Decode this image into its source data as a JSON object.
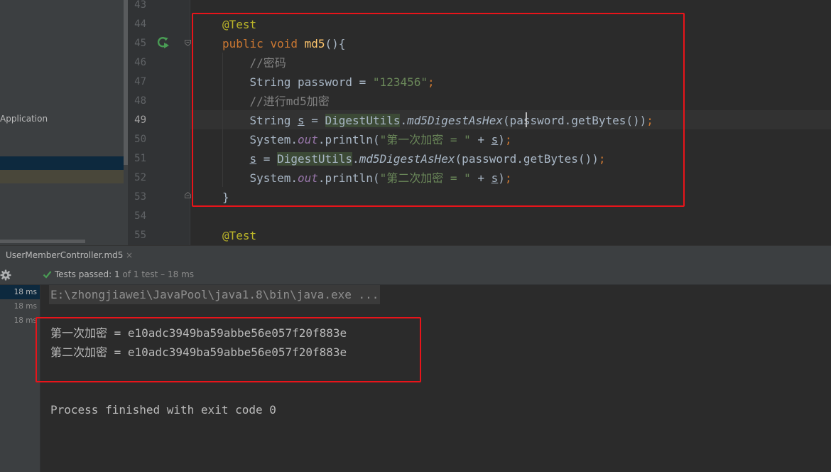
{
  "sidebar": {
    "app_label": "Application"
  },
  "editor": {
    "line_numbers": [
      "43",
      "44",
      "45",
      "46",
      "47",
      "48",
      "49",
      "50",
      "51",
      "52",
      "53",
      "54",
      "55"
    ],
    "lines": [
      [],
      [
        [
          "annot",
          "@Test"
        ]
      ],
      [
        [
          "kw",
          "public "
        ],
        [
          "kw",
          "void "
        ],
        [
          "fn",
          "md5"
        ],
        [
          "plain",
          "(){"
        ]
      ],
      [
        [
          "plain",
          "    "
        ],
        [
          "cmt",
          "//密码"
        ]
      ],
      [
        [
          "plain",
          "    String password = "
        ],
        [
          "str",
          "\"123456\""
        ],
        [
          "kw",
          ";"
        ]
      ],
      [
        [
          "plain",
          "    "
        ],
        [
          "cmt",
          "//进行md5加密"
        ]
      ],
      [
        [
          "plain",
          "    String "
        ],
        [
          "var",
          "s"
        ],
        [
          "plain",
          " = "
        ],
        [
          "cls",
          "DigestUtils"
        ],
        [
          "plain",
          "."
        ],
        [
          "static",
          "md5DigestAsHex"
        ],
        [
          "plain",
          "(password.getBytes())"
        ],
        [
          "kw",
          ";"
        ]
      ],
      [
        [
          "plain",
          "    System."
        ],
        [
          "field",
          "out"
        ],
        [
          "plain",
          ".println("
        ],
        [
          "str",
          "\"第一次加密 = \""
        ],
        [
          "plain",
          " + "
        ],
        [
          "var",
          "s"
        ],
        [
          "plain",
          ")"
        ],
        [
          "kw",
          ";"
        ]
      ],
      [
        [
          "plain",
          "    "
        ],
        [
          "var",
          "s"
        ],
        [
          "plain",
          " = "
        ],
        [
          "cls",
          "DigestUtils"
        ],
        [
          "plain",
          "."
        ],
        [
          "static",
          "md5DigestAsHex"
        ],
        [
          "plain",
          "(password.getBytes())"
        ],
        [
          "kw",
          ";"
        ]
      ],
      [
        [
          "plain",
          "    System."
        ],
        [
          "field",
          "out"
        ],
        [
          "plain",
          ".println("
        ],
        [
          "str",
          "\"第二次加密 = \""
        ],
        [
          "plain",
          " + "
        ],
        [
          "var",
          "s"
        ],
        [
          "plain",
          ")"
        ],
        [
          "kw",
          ";"
        ]
      ],
      [
        [
          "plain",
          "}"
        ]
      ],
      [],
      [
        [
          "annot",
          "@Test"
        ]
      ]
    ]
  },
  "run": {
    "tab_label": "UserMemberController.md5",
    "tab_close": "×",
    "tests_passed": "Tests passed: 1",
    "tests_detail": " of 1 test – 18 ms",
    "tree_times": [
      "18 ms",
      "18 ms",
      "18 ms"
    ],
    "console": {
      "command": "E:\\zhongjiawei\\JavaPool\\java1.8\\bin\\java.exe ...",
      "output": [
        "第一次加密 = e10adc3949ba59abbe56e057f20f883e",
        "第二次加密 = e10adc3949ba59abbe56e057f20f883e"
      ],
      "exit": "Process finished with exit code 0"
    }
  },
  "colors": {
    "annotation_box": "#e8141a",
    "keyword": "#cc7832",
    "string": "#6a8759",
    "function": "#ffc66d",
    "test_pass": "#499c54"
  }
}
